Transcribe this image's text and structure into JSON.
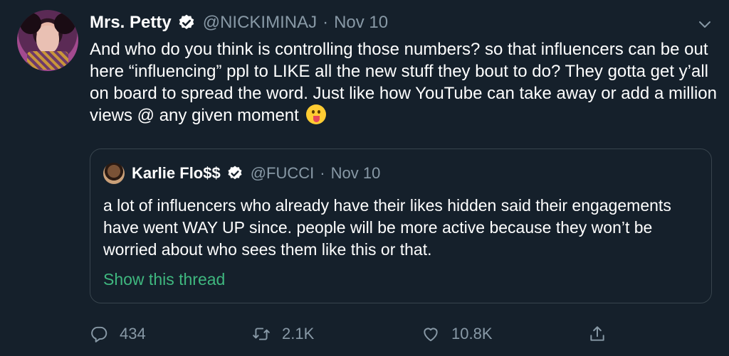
{
  "tweet": {
    "author_name": "Mrs. Petty",
    "handle": "@NICKIMINAJ",
    "separator": "·",
    "date": "Nov 10",
    "text": "And who do you think is controlling those numbers? so that influencers can be out here “influencing” ppl to LIKE all the new stuff they bout to do? They gotta get y’all on board to spread the word. Just like how YouTube can take away or add a million views @ any given moment",
    "emoji": "face-with-tongue-emoji",
    "icons": {
      "verified": "verified-badge-icon",
      "menu": "chevron-down-icon"
    }
  },
  "quoted_tweet": {
    "author_name": "Karlie Flo$$",
    "handle": "@FUCCI",
    "separator": "·",
    "date": "Nov 10",
    "text": "a lot of influencers who already have their likes hidden said their engagements have went WAY UP since. people will be more active because they won’t be worried about who sees them like this or that.",
    "show_thread": "Show this thread"
  },
  "actions": {
    "reply_count": "434",
    "retweet_count": "2.1K",
    "like_count": "10.8K",
    "icons": [
      "reply-icon",
      "retweet-icon",
      "like-icon",
      "share-icon"
    ]
  },
  "colors": {
    "background": "#15202b",
    "secondary_text": "#8899a6",
    "border": "#38444d",
    "thread_link": "#3fb77f"
  }
}
